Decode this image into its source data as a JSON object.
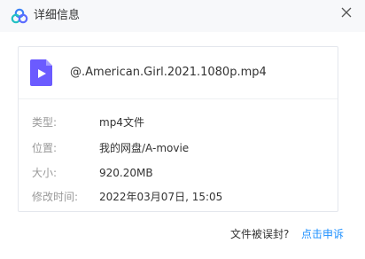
{
  "dialog": {
    "title": "详细信息",
    "close_icon": "close-icon",
    "logo_icon": "cloud-logo-icon"
  },
  "file": {
    "name": "@.American.Girl.2021.1080p.mp4",
    "icon": "video-file-icon",
    "icon_color": "#6b5bff"
  },
  "details": [
    {
      "label": "类型:",
      "value": "mp4文件"
    },
    {
      "label": "位置:",
      "value": "我的网盘/A-movie"
    },
    {
      "label": "大小:",
      "value": "920.20MB"
    },
    {
      "label": "修改时间:",
      "value": "2022年03月07日, 15:05"
    }
  ],
  "footer": {
    "question": "文件被误封?",
    "appeal_link": "点击申诉",
    "link_color": "#1e90ff"
  }
}
